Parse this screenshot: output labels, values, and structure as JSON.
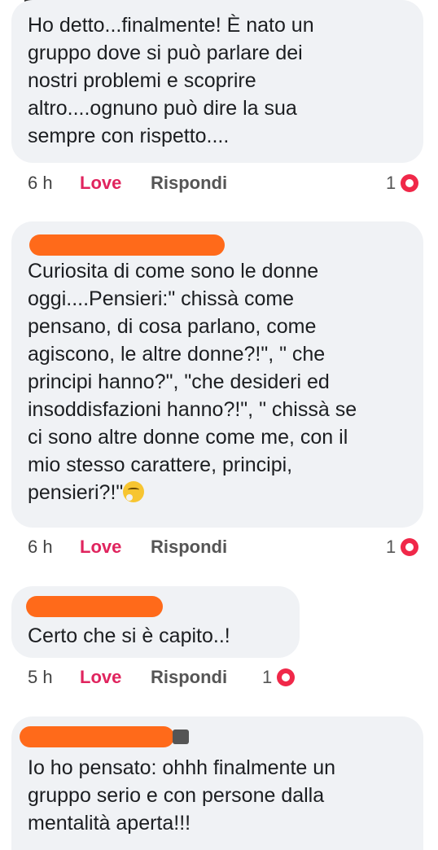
{
  "comments": [
    {
      "text": "Ho detto...finalmente! È nato un\ngruppo dove si può parlare dei\nnostri problemi e scoprire\naltro....ognuno può dire la sua\nsempre con rispetto....",
      "time": "6 h",
      "love": "Love",
      "reply": "Rispondi",
      "reactions": "1"
    },
    {
      "text": "Curiosita di come sono le donne\noggi....Pensieri:\" chissà come\npensano, di cosa parlano, come\nagiscono, le altre donne?!\", \" che\nprincipi hanno?\", \"che desideri ed\ninsoddisfazioni hanno?!\", \" chissà se\nci sono altre donne come me, con il\nmio stesso carattere, principi,\npensieri?!\"",
      "emoji": "thinking-face",
      "time": "6 h",
      "love": "Love",
      "reply": "Rispondi",
      "reactions": "1"
    },
    {
      "text": "Certo  che si  è  capito..!",
      "time": "5 h",
      "love": "Love",
      "reply": "Rispondi",
      "reactions": "1"
    },
    {
      "text": "Io ho pensato: ohhh finalmente un\ngruppo serio e con persone dalla\nmentalità aperta!!!"
    }
  ],
  "colors": {
    "bubble": "#f0f2f5",
    "love": "#e0245e",
    "redaction": "#ff6a1a",
    "heart": "#f02849"
  }
}
